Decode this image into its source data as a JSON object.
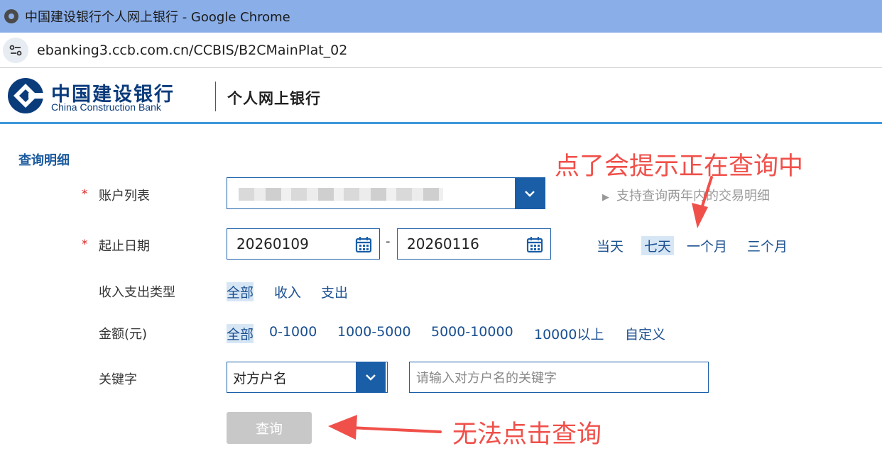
{
  "browser": {
    "window_title": "中国建设银行个人网上银行 - Google Chrome",
    "url": "ebanking3.ccb.com.cn/CCBIS/B2CMainPlat_02"
  },
  "header": {
    "logo_cn": "中国建设银行",
    "logo_en": "China Construction Bank",
    "subtitle": "个人网上银行"
  },
  "page": {
    "section_title": "查询明细"
  },
  "form": {
    "required_mark": "*",
    "account": {
      "label": "账户列表",
      "hint": "支持查询两年内的交易明细"
    },
    "date": {
      "label": "起止日期",
      "start": "20260109",
      "separator": "-",
      "end": "20260116",
      "quick": [
        "当天",
        "七天",
        "一个月",
        "三个月"
      ],
      "quick_active": "七天"
    },
    "type": {
      "label": "收入支出类型",
      "options": [
        "全部",
        "收入",
        "支出"
      ],
      "active": "全部"
    },
    "amount": {
      "label": "金额(元)",
      "options": [
        "全部",
        "0-1000",
        "1000-5000",
        "5000-10000",
        "10000以上",
        "自定义"
      ],
      "active": "全部"
    },
    "keyword": {
      "label": "关键字",
      "select_value": "对方户名",
      "placeholder": "请输入对方户名的关键字"
    },
    "query_button": "查询"
  },
  "annotations": {
    "top": "点了会提示正在查询中",
    "bottom": "无法点击查询"
  },
  "colors": {
    "brand_blue": "#1a5ea8",
    "link_blue": "#1a4f8f",
    "annotation_red": "#f0504a",
    "disabled_gray": "#c8c8c8"
  }
}
